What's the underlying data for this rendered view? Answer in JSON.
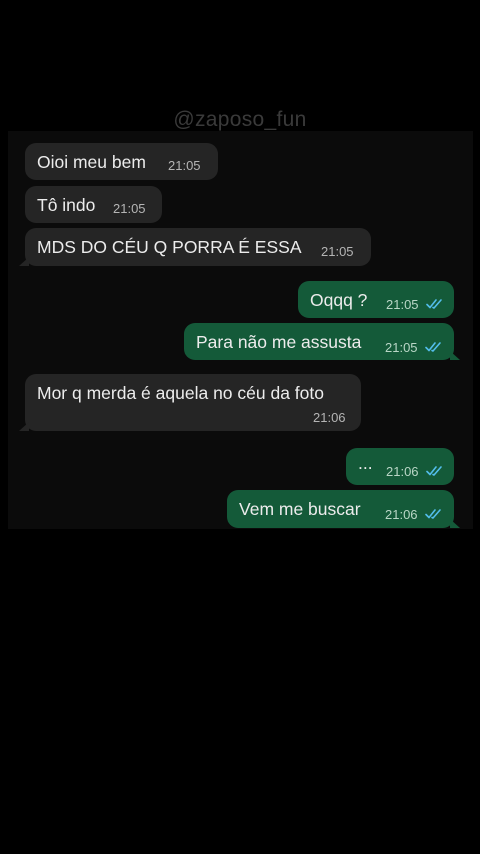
{
  "watermark": "@zaposo_fun",
  "colors": {
    "incoming_bubble": "#252525",
    "outgoing_bubble": "#145a39",
    "read_ticks": "#53bdeb"
  },
  "messages": [
    {
      "direction": "in",
      "text": "Oioi meu bem",
      "time": "21:05"
    },
    {
      "direction": "in",
      "text": "Tô indo",
      "time": "21:05"
    },
    {
      "direction": "in",
      "text": "MDS DO CÉU Q PORRA É ESSA",
      "time": "21:05"
    },
    {
      "direction": "out",
      "text": "Oqqq ?",
      "time": "21:05",
      "status": "read-ticks-icon"
    },
    {
      "direction": "out",
      "text": "Para não me assusta",
      "time": "21:05",
      "status": "read-ticks-icon"
    },
    {
      "direction": "in",
      "text": "Mor q merda é aquela no céu da foto",
      "time": "21:06"
    },
    {
      "direction": "out",
      "text": "...",
      "time": "21:06",
      "status": "read-ticks-icon"
    },
    {
      "direction": "out",
      "text": "Vem me buscar",
      "time": "21:06",
      "status": "read-ticks-icon"
    }
  ]
}
